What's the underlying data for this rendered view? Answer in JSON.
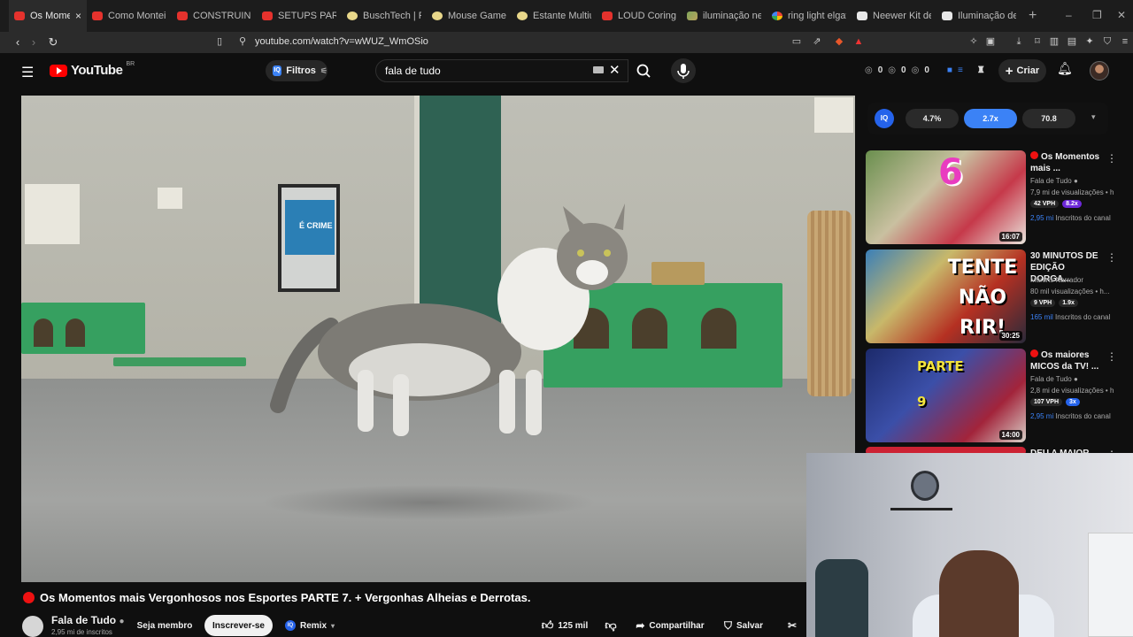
{
  "browser": {
    "tabs": [
      {
        "label": "Os Mome",
        "favicon": "youtube-icon",
        "active": true
      },
      {
        "label": "Como Montei o E",
        "favicon": "youtube-icon"
      },
      {
        "label": "CONSTRUINDO U",
        "favicon": "youtube-icon"
      },
      {
        "label": "SETUPS PARA SE",
        "favicon": "youtube-icon"
      },
      {
        "label": "BuschTech | Perfil",
        "favicon": "yellow-icon"
      },
      {
        "label": "Mouse Gamer Se",
        "favicon": "yellow-icon"
      },
      {
        "label": "Estante Multiuso",
        "favicon": "yellow-icon"
      },
      {
        "label": "LOUD Coringa - Y",
        "favicon": "youtube-icon"
      },
      {
        "label": "iluminação neew",
        "favicon": "photo-icon"
      },
      {
        "label": "ring light elgato",
        "favicon": "google-icon"
      },
      {
        "label": "Neewer Kit de lu",
        "favicon": "white-icon"
      },
      {
        "label": "Iluminação de LE",
        "favicon": "white-icon"
      }
    ],
    "url": "youtube.com/watch?v=wWUZ_WmOSio"
  },
  "youtube": {
    "logo_text": "YouTube",
    "country": "BR",
    "filters_label": "Filtros",
    "search_value": "fala de tudo",
    "header_stats": [
      "0",
      "0",
      "0"
    ],
    "create_label": "Criar"
  },
  "video": {
    "title": "Os Momentos mais Vergonhosos nos Esportes PARTE 7. + Vergonhas Alheias e Derrotas.",
    "channel": "Fala de Tudo",
    "subscribers": "2,95 mi de inscritos",
    "join_label": "Seja membro",
    "subscribe_label": "Inscrever-se",
    "remix_label": "Remix",
    "likes": "125 mil",
    "share_label": "Compartilhar",
    "save_label": "Salvar",
    "poster_text": "É CRIME"
  },
  "iq_bar": {
    "logo": "IQ",
    "values": [
      "4.7%",
      "2.7x",
      "70.8"
    ]
  },
  "recommendations": [
    {
      "title": "Os Momentos mais ...",
      "live_dot": true,
      "channel": "Fala de Tudo",
      "views": "7,9 mi de visualizações • h",
      "vph": "42 VPH",
      "multiplier": "8.2x",
      "subs_value": "2,95 mi",
      "subs_label": "Inscritos do canal",
      "duration": "16:07",
      "thumb_text": "6"
    },
    {
      "title": "30 MINUTOS DE EDIÇÃO DORGA...",
      "live_dot": false,
      "channel": "Martins Narrador",
      "views": "80 mil visualizações • h...",
      "vph": "9 VPH",
      "multiplier": "1.9x",
      "subs_value": "165 mil",
      "subs_label": "Inscritos do canal",
      "duration": "30:25",
      "thumb_text": "TENTE NÃO RIR!"
    },
    {
      "title": "Os maiores MICOS da TV! ...",
      "live_dot": true,
      "channel": "Fala de Tudo",
      "views": "2,8 mi de visualizações • h",
      "vph": "107 VPH",
      "multiplier": "3x",
      "subs_value": "2,95 mi",
      "subs_label": "Inscritos do canal",
      "duration": "14:00",
      "thumb_text": "PARTE 9"
    },
    {
      "title": "DEU A MAIOR",
      "live_dot": false
    }
  ]
}
